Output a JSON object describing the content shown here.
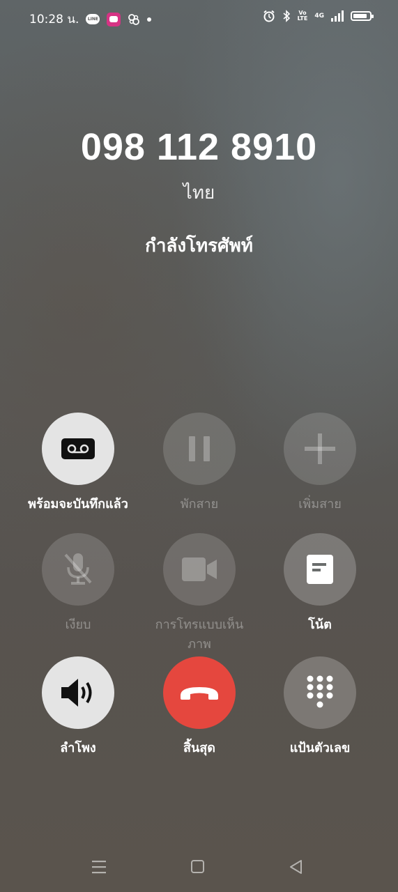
{
  "status_bar": {
    "time": "10:28 น.",
    "line_icon_text": "LINE",
    "volte_top": "Vo",
    "volte_bottom": "LTE",
    "network": "4G",
    "icons": [
      "line-icon",
      "app-icon",
      "pinwheel-icon",
      "dot-icon",
      "alarm-icon",
      "bluetooth-icon",
      "volte-icon",
      "signal-icon",
      "battery-icon"
    ]
  },
  "call": {
    "phone_number": "098 112 8910",
    "region": "ไทย",
    "status": "กำลังโทรศัพท์"
  },
  "controls": {
    "record": {
      "label": "พร้อมจะบันทึกแล้ว",
      "icon": "recorder-icon"
    },
    "hold": {
      "label": "พักสาย",
      "icon": "pause-icon"
    },
    "add_call": {
      "label": "เพิ่มสาย",
      "icon": "plus-icon"
    },
    "mute": {
      "label": "เงียบ",
      "icon": "mic-off-icon"
    },
    "video_call": {
      "label": "การโทรแบบเห็นภาพ",
      "icon": "video-camera-icon"
    },
    "notes": {
      "label": "โน้ต",
      "icon": "note-icon"
    },
    "speaker": {
      "label": "ลำโพง",
      "icon": "speaker-icon"
    },
    "end_call": {
      "label": "สิ้นสุด",
      "icon": "hang-up-icon"
    },
    "keypad": {
      "label": "แป้นตัวเลข",
      "icon": "dialpad-icon"
    }
  },
  "colors": {
    "end_call": "#e5473e",
    "active_button": "#e4e4e4"
  }
}
